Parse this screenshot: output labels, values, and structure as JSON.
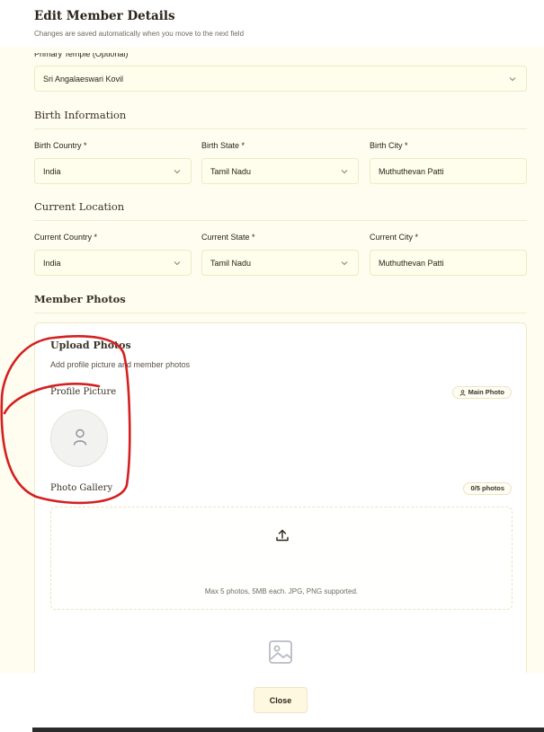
{
  "dialog": {
    "title": "Edit Member Details",
    "subtitle": "Changes are saved automatically when you move to the next field"
  },
  "primary_temple": {
    "label": "Primary Temple (Optional)",
    "value": "Sri Angalaeswari Kovil"
  },
  "birth": {
    "heading": "Birth Information",
    "country_label": "Birth Country *",
    "country_value": "India",
    "state_label": "Birth State *",
    "state_value": "Tamil Nadu",
    "city_label": "Birth City *",
    "city_value": "Muthuthevan Patti"
  },
  "current": {
    "heading": "Current Location",
    "country_label": "Current Country *",
    "country_value": "India",
    "state_label": "Current State *",
    "state_value": "Tamil Nadu",
    "city_label": "Current City *",
    "city_value": "Muthuthevan Patti"
  },
  "photos": {
    "heading": "Member Photos",
    "upload_title": "Upload Photos",
    "upload_desc": "Add profile picture and member photos",
    "profile_label": "Profile Picture",
    "main_badge": "Main Photo",
    "gallery_label": "Photo Gallery",
    "gallery_count": "0/5 photos",
    "dropzone_note": "Max 5 photos, 5MB each. JPG, PNG supported."
  },
  "footer": {
    "close_label": "Close"
  },
  "colors": {
    "background": "#fffdf0",
    "accent_border": "#f0e9c4",
    "annotation": "#d42020"
  },
  "icons": [
    "chevron-down-icon",
    "user-icon",
    "upload-icon",
    "image-icon"
  ]
}
